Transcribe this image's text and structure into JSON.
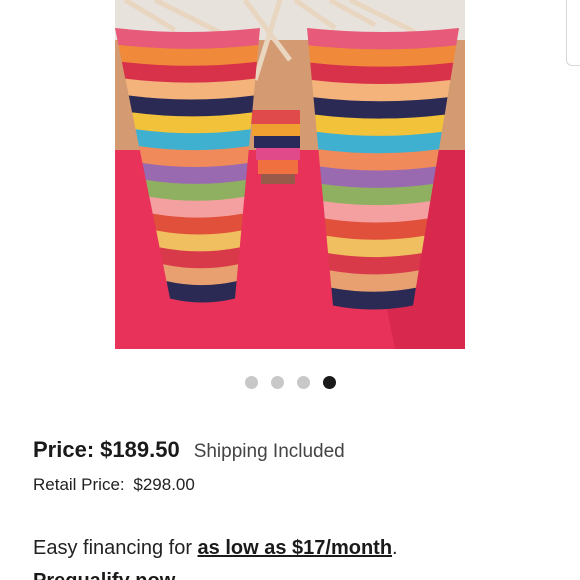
{
  "carousel": {
    "dot_count": 4,
    "active_index": 3
  },
  "price": {
    "label": "Price:",
    "value": "$189.50",
    "shipping": "Shipping Included"
  },
  "retail": {
    "label": "Retail Price:",
    "value": "$298.00"
  },
  "financing": {
    "prefix": "Easy financing for ",
    "link": "as low as $17/month",
    "suffix": "."
  },
  "cutoff_line": {
    "text": "Prequalify now"
  },
  "colors": {
    "dot_inactive": "#c8c8c8",
    "dot_active": "#1a1a1a",
    "backdrop_pink": "#e8325a"
  }
}
